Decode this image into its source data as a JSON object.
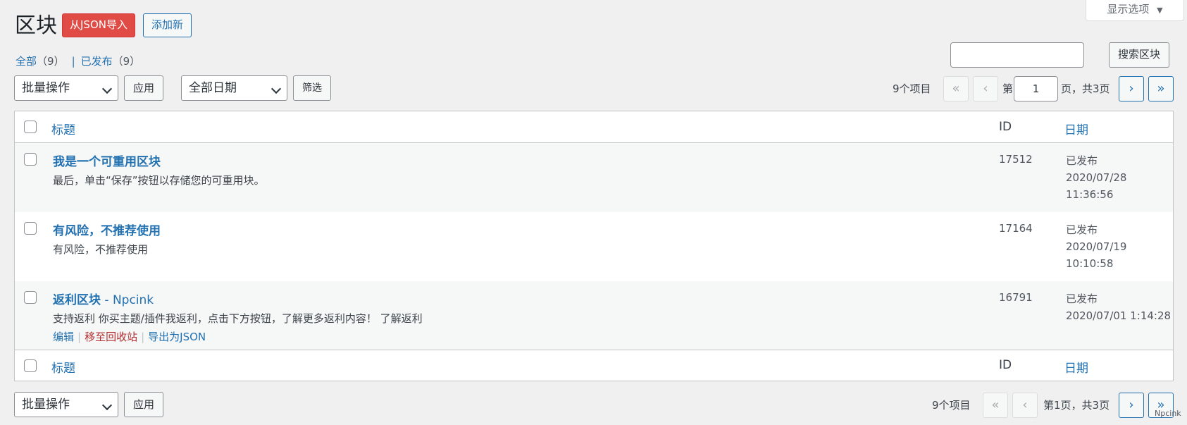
{
  "header": {
    "title": "区块",
    "import_label": "从JSON导入",
    "add_new_label": "添加新",
    "screen_options_label": "显示选项"
  },
  "views": {
    "all_label": "全部",
    "all_count": "（9）",
    "separator": "|",
    "published_label": "已发布",
    "published_count": "（9）"
  },
  "search": {
    "value": "",
    "button_label": "搜索区块"
  },
  "top_nav": {
    "bulk_select": "批量操作",
    "apply_label": "应用",
    "date_select": "全部日期",
    "filter_label": "筛选",
    "items_count": "9个项目",
    "first": "«",
    "prev": "‹",
    "page_prefix": "第",
    "current_page": "1",
    "page_suffix": "页，共3页",
    "next": "›",
    "last": "»"
  },
  "table": {
    "columns": {
      "title": "标题",
      "id": "ID",
      "date": "日期"
    },
    "rows": [
      {
        "title": "我是一个可重用区块",
        "title_suffix": "",
        "excerpt": "最后，单击“保存”按钮以存储您的可重用块。",
        "id": "17512",
        "status": "已发布",
        "date": "2020/07/28",
        "time": "11:36:56"
      },
      {
        "title": "有风险，不推荐使用",
        "title_suffix": "",
        "excerpt": "有风险，不推荐使用",
        "id": "17164",
        "status": "已发布",
        "date": "2020/07/19",
        "time": "10:10:58"
      },
      {
        "title": "返利区块",
        "title_suffix": " - Npcink",
        "excerpt": "支持返利 你买主题/插件我返利，点击下方按钮，了解更多返利内容！ 了解返利",
        "id": "16791",
        "status": "已发布",
        "date": "2020/07/01 1:14:28",
        "time": "",
        "actions": {
          "edit": "编辑",
          "trash": "移至回收站",
          "export": "导出为JSON",
          "pipe": "|"
        }
      }
    ]
  },
  "bottom_nav": {
    "bulk_select": "批量操作",
    "apply_label": "应用",
    "items_count": "9个项目",
    "first": "«",
    "prev": "‹",
    "page_info": "第1页，共3页",
    "next": "›",
    "last": "»"
  },
  "watermark": "Npcink"
}
